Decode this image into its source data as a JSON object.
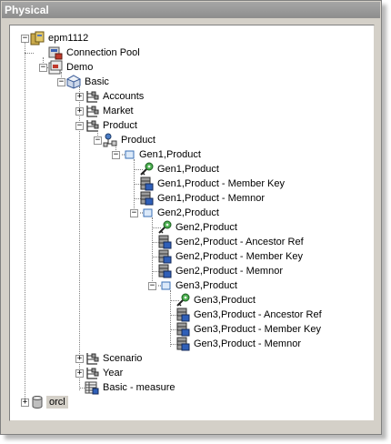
{
  "window": {
    "title": "Physical"
  },
  "tree": {
    "nodes": [
      {
        "label": "epm1112",
        "icon": "database-server-icon",
        "expander": "−"
      },
      {
        "label": "Connection Pool",
        "icon": "connection-pool-icon"
      },
      {
        "label": "Demo",
        "icon": "catalog-icon",
        "expander": "−"
      },
      {
        "label": "Basic",
        "icon": "cube-schema-icon",
        "expander": "−"
      },
      {
        "label": "Accounts",
        "icon": "hierarchy-dimension-icon",
        "expander": "+"
      },
      {
        "label": "Market",
        "icon": "hierarchy-dimension-icon",
        "expander": "+"
      },
      {
        "label": "Product",
        "icon": "hierarchy-dimension-icon",
        "expander": "−"
      },
      {
        "label": "Product",
        "icon": "hierarchy-icon",
        "expander": "−"
      },
      {
        "label": "Gen1,Product",
        "icon": "level-icon",
        "expander": "−"
      },
      {
        "label": "Gen1,Product",
        "icon": "key-column-icon"
      },
      {
        "label": "Gen1,Product - Member Key",
        "icon": "column-icon"
      },
      {
        "label": "Gen1,Product - Memnor",
        "icon": "column-icon"
      },
      {
        "label": "Gen2,Product",
        "icon": "level-icon",
        "expander": "−"
      },
      {
        "label": "Gen2,Product",
        "icon": "key-column-icon"
      },
      {
        "label": "Gen2,Product - Ancestor Ref",
        "icon": "column-icon"
      },
      {
        "label": "Gen2,Product - Member Key",
        "icon": "column-icon"
      },
      {
        "label": "Gen2,Product - Memnor",
        "icon": "column-icon"
      },
      {
        "label": "Gen3,Product",
        "icon": "level-icon",
        "expander": "−"
      },
      {
        "label": "Gen3,Product",
        "icon": "key-column-icon"
      },
      {
        "label": "Gen3,Product - Ancestor Ref",
        "icon": "column-icon"
      },
      {
        "label": "Gen3,Product - Member Key",
        "icon": "column-icon"
      },
      {
        "label": "Gen3,Product - Memnor",
        "icon": "column-icon"
      },
      {
        "label": "Scenario",
        "icon": "hierarchy-dimension-icon",
        "expander": "+"
      },
      {
        "label": "Year",
        "icon": "hierarchy-dimension-icon",
        "expander": "+"
      },
      {
        "label": "Basic - measure",
        "icon": "measure-table-icon"
      },
      {
        "label": "orcl",
        "icon": "database-icon",
        "expander": "+"
      }
    ]
  }
}
